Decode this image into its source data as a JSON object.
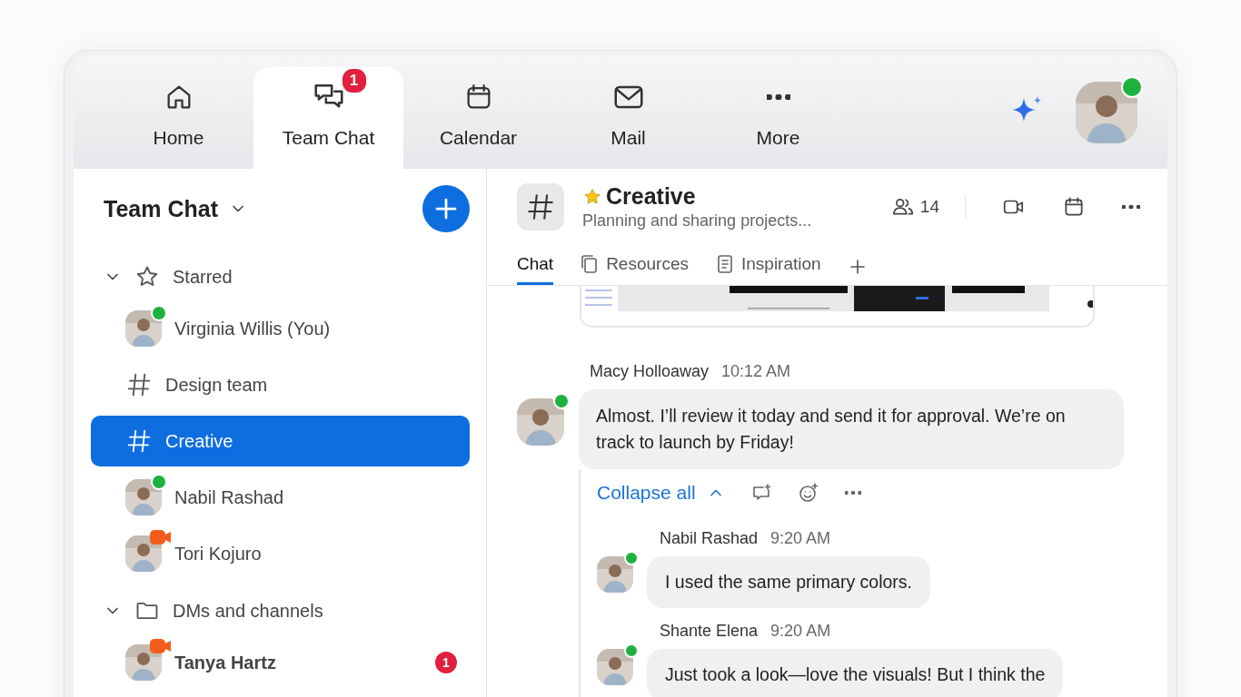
{
  "nav": {
    "tabs": [
      {
        "label": "Home",
        "selected": false
      },
      {
        "label": "Team Chat",
        "selected": true,
        "badge": "1"
      },
      {
        "label": "Calendar",
        "selected": false
      },
      {
        "label": "Mail",
        "selected": false
      },
      {
        "label": "More",
        "selected": false
      }
    ],
    "profile": {
      "online": true
    }
  },
  "sidebar": {
    "title": "Team Chat",
    "items": [
      {
        "kind": "starred",
        "label": "Starred",
        "expanded": true
      },
      {
        "kind": "person",
        "label": "Virginia Willis (You)",
        "online": true,
        "selected": false
      },
      {
        "kind": "channel",
        "label": "Design team",
        "selected": false
      },
      {
        "kind": "channel",
        "label": "Creative",
        "selected": true
      },
      {
        "kind": "person",
        "label": "Nabil Rashad",
        "online": true,
        "selected": false
      },
      {
        "kind": "person",
        "label": "Tori Kojuro",
        "in_meeting": true,
        "selected": false
      },
      {
        "kind": "folder",
        "label": "DMs and channels",
        "expanded": true
      },
      {
        "kind": "person",
        "label": "Tanya Hartz",
        "in_meeting": true,
        "selected": false,
        "unread": true,
        "badge": "1"
      }
    ]
  },
  "channel": {
    "title": "Creative",
    "starred": true,
    "subtitle": "Planning and sharing projects...",
    "members": "14",
    "tabs": [
      {
        "label": "Chat",
        "selected": true
      },
      {
        "label": "Resources",
        "selected": false
      },
      {
        "label": "Inspiration",
        "selected": false
      }
    ]
  },
  "messages": [
    {
      "author": "Macy Holloaway",
      "time": "10:12 AM",
      "online": true,
      "text": "Almost. I’ll review it today and send it for approval. We’re on track to launch by Friday!",
      "thread": {
        "toggle": "Collapse all",
        "expanded": true,
        "replies": [
          {
            "author": "Nabil Rashad",
            "time": "9:20 AM",
            "online": true,
            "text": "I used the same primary colors."
          },
          {
            "author": "Shante Elena",
            "time": "9:20 AM",
            "online": true,
            "text": "Just took a look—love the visuals! But I think the"
          }
        ]
      }
    }
  ]
}
